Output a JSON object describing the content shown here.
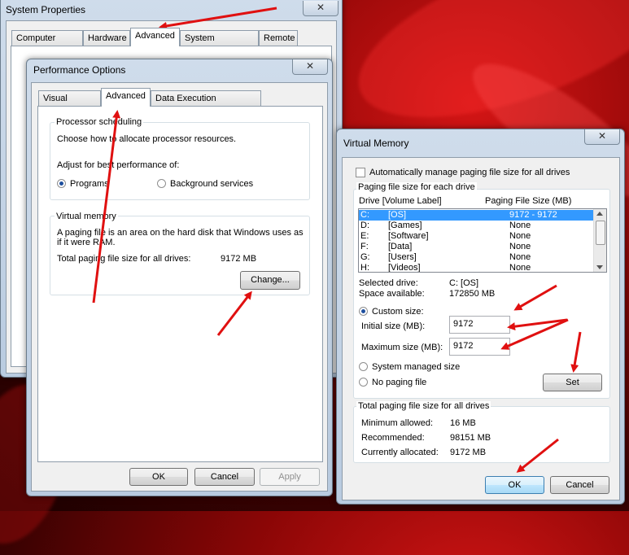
{
  "system_properties": {
    "title": "System Properties",
    "close": "✕",
    "tabs": [
      "Computer Name",
      "Hardware",
      "Advanced",
      "System Protection",
      "Remote"
    ]
  },
  "performance_options": {
    "title": "Performance Options",
    "close": "✕",
    "tabs": [
      "Visual Effects",
      "Advanced",
      "Data Execution Prevention"
    ],
    "processor": {
      "group_label": "Processor scheduling",
      "desc": "Choose how to allocate processor resources.",
      "adjust_label": "Adjust for best performance of:",
      "opt_programs": "Programs",
      "opt_background": "Background services",
      "selected": "Programs"
    },
    "virtual_memory": {
      "group_label": "Virtual memory",
      "desc_line1": "A paging file is an area on the hard disk that Windows uses as",
      "desc_line2": "if it were RAM.",
      "total_label": "Total paging file size for all drives:",
      "total_value": "9172 MB",
      "change_button": "Change..."
    },
    "buttons": {
      "ok": "OK",
      "cancel": "Cancel",
      "apply": "Apply"
    }
  },
  "virtual_memory": {
    "title": "Virtual Memory",
    "close": "✕",
    "auto_manage": "Automatically manage paging file size for all drives",
    "auto_manage_checked": false,
    "paging_group_label": "Paging file size for each drive",
    "col_drive": "Drive  [Volume Label]",
    "col_size": "Paging File Size (MB)",
    "drives": [
      {
        "drive": "C:",
        "label": "[OS]",
        "size": "9172 - 9172",
        "selected": true
      },
      {
        "drive": "D:",
        "label": "[Games]",
        "size": "None",
        "selected": false
      },
      {
        "drive": "E:",
        "label": "[Software]",
        "size": "None",
        "selected": false
      },
      {
        "drive": "F:",
        "label": "[Data]",
        "size": "None",
        "selected": false
      },
      {
        "drive": "G:",
        "label": "[Users]",
        "size": "None",
        "selected": false
      },
      {
        "drive": "H:",
        "label": "[Videos]",
        "size": "None",
        "selected": false
      }
    ],
    "selected_drive_label": "Selected drive:",
    "selected_drive_value": "C:  [OS]",
    "space_label": "Space available:",
    "space_value": "172850 MB",
    "custom_size": "Custom size:",
    "initial_label": "Initial size (MB):",
    "initial_value": "9172",
    "max_label": "Maximum size (MB):",
    "max_value": "9172",
    "system_managed": "System managed size",
    "no_paging": "No paging file",
    "selected_option": "Custom size",
    "set_button": "Set",
    "total_group_label": "Total paging file size for all drives",
    "min_label": "Minimum allowed:",
    "min_value": "16 MB",
    "rec_label": "Recommended:",
    "rec_value": "98151 MB",
    "cur_label": "Currently allocated:",
    "cur_value": "9172 MB",
    "buttons": {
      "ok": "OK",
      "cancel": "Cancel"
    }
  },
  "colors": {
    "arrow": "#e01010",
    "selection": "#3399ff",
    "accent_default_button": "#3c7fb1"
  }
}
